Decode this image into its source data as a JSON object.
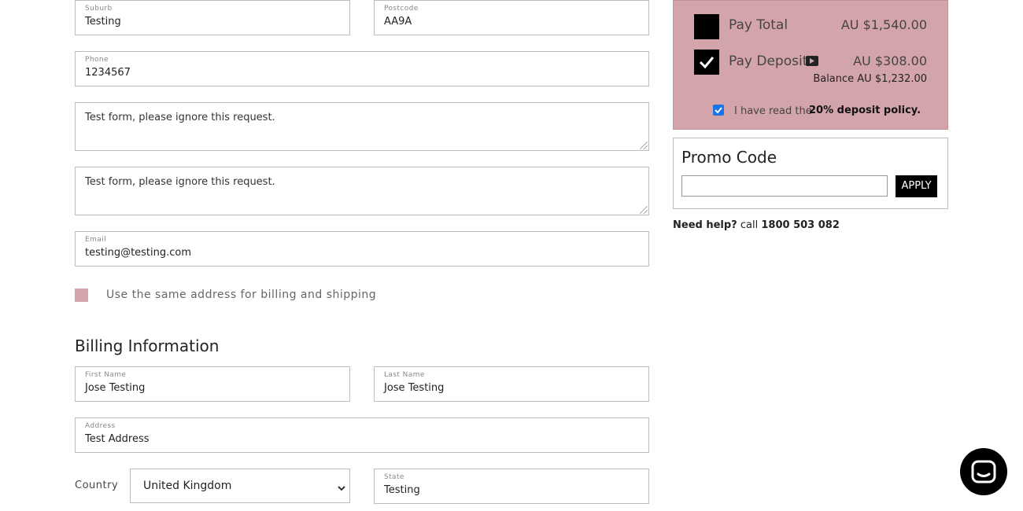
{
  "shipping": {
    "suburb": {
      "label": "Suburb",
      "value": "Testing"
    },
    "postcode": {
      "label": "Postcode",
      "value": "AA9A"
    },
    "phone": {
      "label": "Phone",
      "value": "1234567"
    },
    "notes1": "Test form, please ignore this request.",
    "notes2": "Test form, please ignore this request.",
    "email": {
      "label": "Email",
      "value": "testing@testing.com"
    },
    "same_address_label": "Use the same address for billing and shipping"
  },
  "billing": {
    "heading": "Billing Information",
    "first_name": {
      "label": "First Name",
      "value": "Jose Testing"
    },
    "last_name": {
      "label": "Last Name",
      "value": "Jose Testing"
    },
    "address": {
      "label": "Address",
      "value": "Test Address"
    },
    "country": {
      "label": "Country",
      "value": "United Kingdom"
    },
    "state": {
      "label": "State",
      "value": "Testing"
    }
  },
  "payment": {
    "total_label": "Pay Total",
    "total_amount": "AU $1,540.00",
    "total_selected": false,
    "deposit_label": "Pay Deposit",
    "deposit_amount": "AU $308.00",
    "deposit_selected": true,
    "balance": "Balance AU $1,232.00",
    "policy_prefix": "I have read the",
    "policy_link": "20% deposit policy.",
    "policy_checked": true
  },
  "promo": {
    "heading": "Promo Code",
    "input_value": "",
    "apply_label": "APPLY"
  },
  "help": {
    "prefix": "Need help?",
    "middle": "call",
    "phone": "1800 503 082"
  },
  "colors": {
    "panel_bg": "#d4a4ab",
    "accent_checkbox": "#d4a4ab"
  },
  "icons": {
    "deposit_info": "play-icon",
    "chat": "chat-icon",
    "select": "chevron-down-icon"
  }
}
